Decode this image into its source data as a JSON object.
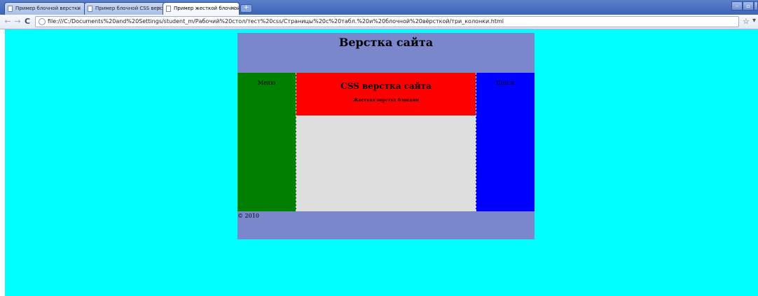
{
  "browser": {
    "tabs": [
      {
        "title": "Пример блочной верстки"
      },
      {
        "title": "Пример блочной CSS верс..."
      },
      {
        "title": "Пример жесткой блочной ..."
      }
    ],
    "new_tab": "+",
    "close_glyph": "×",
    "window_controls": {
      "minimize": "–",
      "maximize": "▫",
      "close": "×"
    },
    "nav": {
      "back": "←",
      "forward": "→",
      "reload": "C"
    },
    "address": "file:///C:/Documents%20and%20Settings/student_m/Рабочий%20стол/тест%20css/Страницы%20с%20табл.%20и%20блочной%20вёрсткой/три_колонки.html",
    "star": "☆",
    "wrench": "▾"
  },
  "page": {
    "header_title": "Верстка сайта",
    "menu_label": "Меню",
    "main_title": "CSS верстка сайта",
    "main_subtitle": "Жесткая верстка блоками",
    "search_label": "Поиск",
    "footer_text": "© 2010"
  },
  "colors": {
    "background": "#00ffff",
    "header_footer": "#7b87cd",
    "menu": "#008000",
    "banner": "#ff0000",
    "content": "#dedede",
    "search": "#0000ff"
  }
}
